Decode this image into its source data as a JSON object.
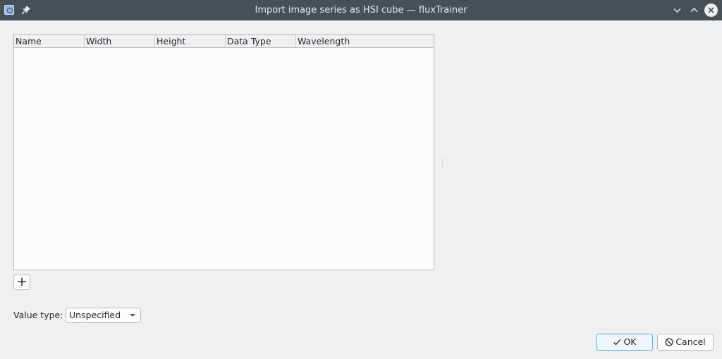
{
  "window": {
    "title": "Import image series as HSI cube — fluxTrainer",
    "icons": [
      "app-icon",
      "pin-icon",
      "minimize-icon",
      "maximize-icon",
      "close-icon"
    ]
  },
  "table": {
    "columns": [
      "Name",
      "Width",
      "Height",
      "Data Type",
      "Wavelength"
    ],
    "rows": []
  },
  "add_button": {
    "label": "+"
  },
  "value_type": {
    "label": "Value type:",
    "selected": "Unspecified"
  },
  "buttons": {
    "ok": "OK",
    "cancel": "Cancel"
  },
  "colors": {
    "titlebar": "#475057",
    "window_bg": "#eff0f1",
    "accent": "#3daee9"
  }
}
